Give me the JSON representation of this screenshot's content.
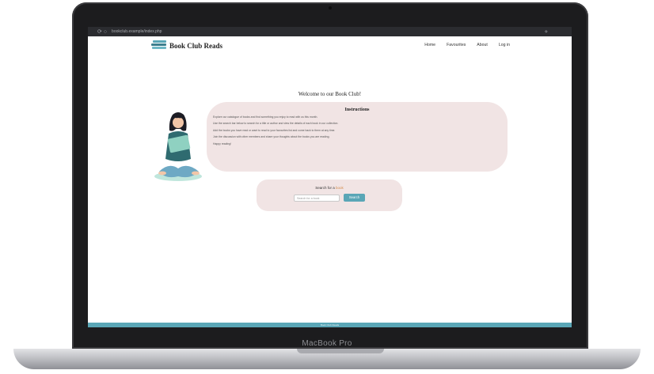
{
  "device": {
    "label": "MacBook Pro"
  },
  "browser": {
    "url": "bookclub.example/index.php"
  },
  "site": {
    "name": "Book Club Reads",
    "nav": [
      "Home",
      "Favourites",
      "About",
      "Log in"
    ]
  },
  "main": {
    "welcome": "Welcome to our Book Club!",
    "instructions": {
      "title": "Instructions",
      "paragraphs": [
        "Explore our catalogue of books and find something you enjoy to read with us this month.",
        "Use the search bar below to search for a title or author and view the details of each book in our collection.",
        "Add the books you have read or want to read to your favourites list and come back to them at any time.",
        "Join the discussion with other members and share your thoughts about the books you are reading.",
        "Happy reading!"
      ]
    },
    "search": {
      "label_prefix": "Search for a ",
      "label_highlight": "book",
      "placeholder": "Search for a book",
      "button": "Search"
    }
  },
  "footer": {
    "text": "Book Club Reads"
  },
  "colors": {
    "accent": "#5aa6b6",
    "panel": "#f1e4e4",
    "highlight": "#d48b4a"
  }
}
